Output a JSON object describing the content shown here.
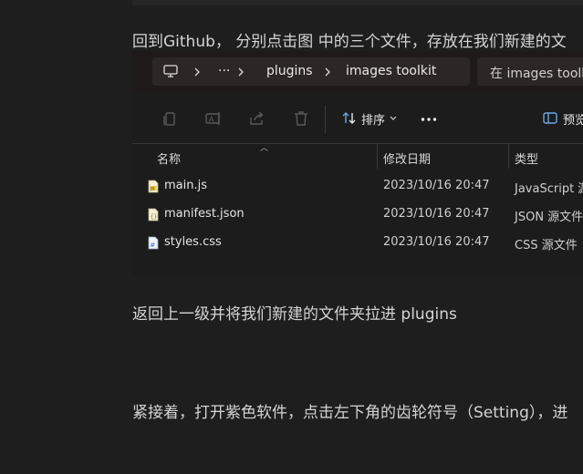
{
  "article": {
    "paragraph_1": "回到Github， 分别点击图 中的三个文件，存放在我们新建的文",
    "paragraph_2": "返回上一级并将我们新建的文件夹拉进 plugins",
    "paragraph_3": "紧接着，打开紫色软件，点击左下角的齿轮符号（Setting），进"
  },
  "explorer": {
    "address": {
      "icon": "computer-icon",
      "ellipsis": "···",
      "segments": [
        "plugins",
        "images toolkit"
      ]
    },
    "search_placeholder": "在 images toolkit",
    "toolbar": {
      "icons": [
        "copy-icon",
        "rename-icon",
        "share-icon",
        "delete-icon"
      ],
      "sort_label": "排序",
      "more_label": "···",
      "preview_label": "预览"
    },
    "columns": {
      "name": "名称",
      "date": "修改日期",
      "type": "类型"
    },
    "files": [
      {
        "name": "main.js",
        "date": "2023/10/16 20:47",
        "type": "JavaScript 源",
        "icon": "js-file-icon"
      },
      {
        "name": "manifest.json",
        "date": "2023/10/16 20:47",
        "type": "JSON 源文件",
        "icon": "json-file-icon"
      },
      {
        "name": "styles.css",
        "date": "2023/10/16 20:47",
        "type": "CSS 源文件",
        "icon": "css-file-icon"
      }
    ]
  }
}
